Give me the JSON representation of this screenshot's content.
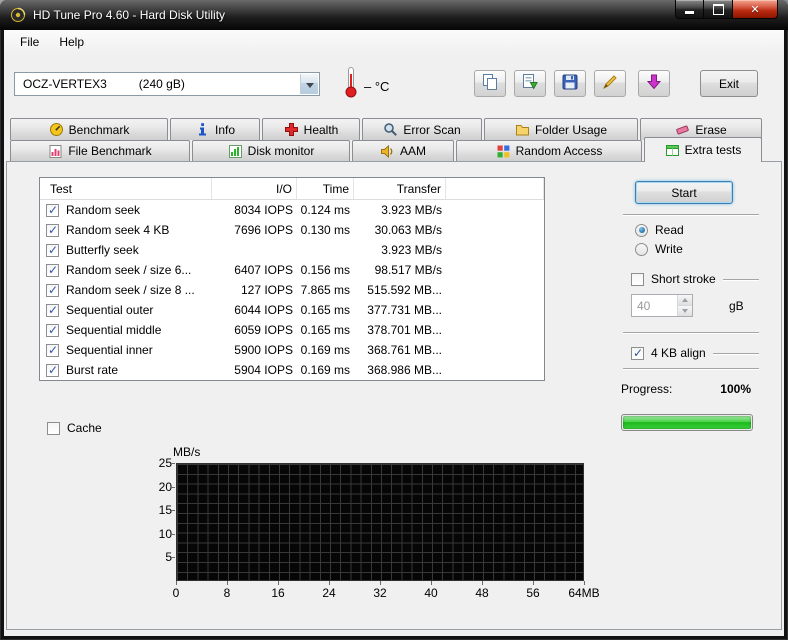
{
  "window": {
    "title": "HD Tune Pro 4.60 - Hard Disk Utility"
  },
  "menu": {
    "file": "File",
    "help": "Help"
  },
  "toolbar": {
    "drive_name": "OCZ-VERTEX3",
    "drive_capacity": "(240 gB)",
    "temperature": "– °C",
    "exit_label": "Exit"
  },
  "tabs": {
    "row1": [
      {
        "label": "Benchmark"
      },
      {
        "label": "Info"
      },
      {
        "label": "Health"
      },
      {
        "label": "Error Scan"
      },
      {
        "label": "Folder Usage"
      },
      {
        "label": "Erase"
      }
    ],
    "row2": [
      {
        "label": "File Benchmark"
      },
      {
        "label": "Disk monitor"
      },
      {
        "label": "AAM"
      },
      {
        "label": "Random Access"
      },
      {
        "label": "Extra tests"
      }
    ],
    "active": "Extra tests"
  },
  "results": {
    "headers": {
      "test": "Test",
      "io": "I/O",
      "time": "Time",
      "transfer": "Transfer"
    },
    "rows": [
      {
        "checked": true,
        "test": "Random seek",
        "io": "8034 IOPS",
        "time": "0.124 ms",
        "transfer": "3.923 MB/s"
      },
      {
        "checked": true,
        "test": "Random seek 4 KB",
        "io": "7696 IOPS",
        "time": "0.130 ms",
        "transfer": "30.063 MB/s"
      },
      {
        "checked": true,
        "test": "Butterfly seek",
        "io": "",
        "time": "",
        "transfer": "3.923 MB/s"
      },
      {
        "checked": true,
        "test": "Random seek / size 6...",
        "io": "6407 IOPS",
        "time": "0.156 ms",
        "transfer": "98.517 MB/s"
      },
      {
        "checked": true,
        "test": "Random seek / size 8 ...",
        "io": "127 IOPS",
        "time": "7.865 ms",
        "transfer": "515.592 MB..."
      },
      {
        "checked": true,
        "test": "Sequential outer",
        "io": "6044 IOPS",
        "time": "0.165 ms",
        "transfer": "377.731 MB..."
      },
      {
        "checked": true,
        "test": "Sequential middle",
        "io": "6059 IOPS",
        "time": "0.165 ms",
        "transfer": "378.701 MB..."
      },
      {
        "checked": true,
        "test": "Sequential inner",
        "io": "5900 IOPS",
        "time": "0.169 ms",
        "transfer": "368.761 MB..."
      },
      {
        "checked": true,
        "test": "Burst rate",
        "io": "5904 IOPS",
        "time": "0.169 ms",
        "transfer": "368.986 MB..."
      }
    ]
  },
  "controls": {
    "start": "Start",
    "read": "Read",
    "write": "Write",
    "read_selected": true,
    "write_selected": false,
    "short_stroke": "Short stroke",
    "short_stroke_checked": false,
    "stroke_value": "40",
    "stroke_unit": "gB",
    "align": "4 KB align",
    "align_checked": true,
    "progress_label": "Progress:",
    "progress_value": "100%",
    "progress_percent": 100
  },
  "cache": {
    "label": "Cache",
    "checked": false
  },
  "chart_data": {
    "type": "line",
    "title": "",
    "ylabel": "MB/s",
    "xlabel": "",
    "y_ticks": [
      "25",
      "20",
      "15",
      "10",
      "5"
    ],
    "x_ticks": [
      "0",
      "8",
      "16",
      "24",
      "32",
      "40",
      "48",
      "56",
      "64MB"
    ],
    "ylim": [
      0,
      25
    ],
    "grid": true,
    "plot_background": "#000000",
    "series": []
  }
}
